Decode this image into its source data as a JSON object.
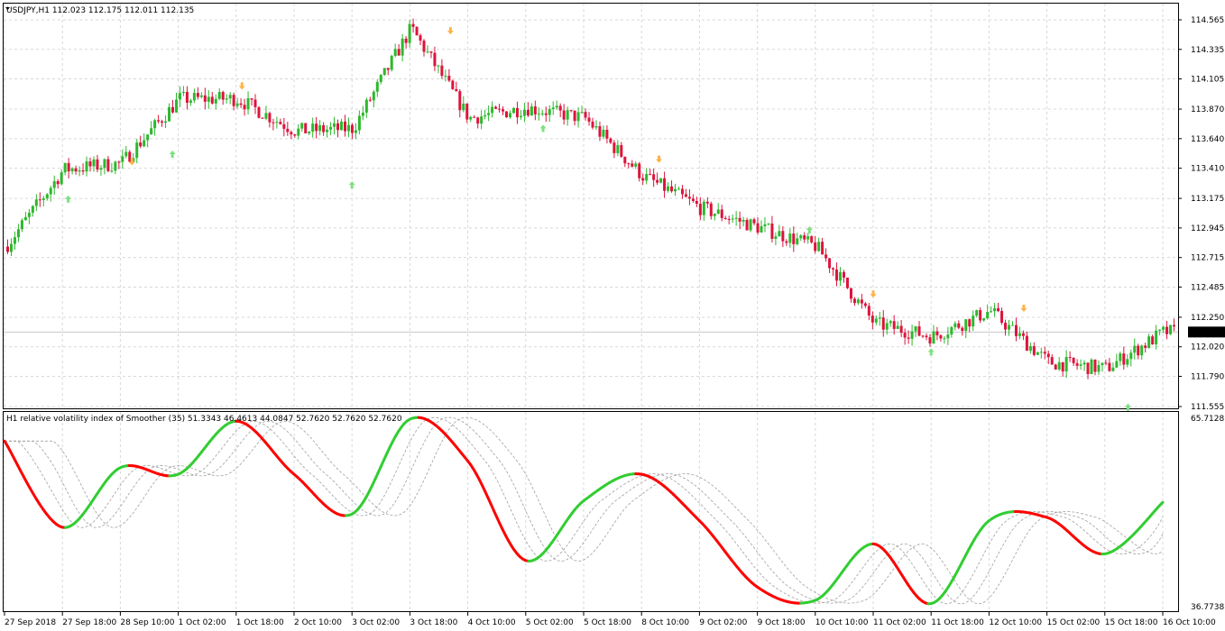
{
  "main_panel": {
    "header": "USDJPY,H1  112.023 112.175 112.011 112.135",
    "current_price": "112.135",
    "price_labels": [
      "114.565",
      "114.335",
      "114.105",
      "113.870",
      "113.640",
      "113.410",
      "113.175",
      "112.945",
      "112.715",
      "112.485",
      "112.250",
      "112.020",
      "111.790",
      "111.555"
    ]
  },
  "indicator_panel": {
    "header": "H1 relative volatility index of Smoother (35) 51.3343 46.4613 44.0847 52.7620 52.7620 52.7620",
    "scale_top": "65.7128",
    "scale_bottom": "36.7738"
  },
  "time_labels": [
    "27 Sep 2018",
    "27 Sep 18:00",
    "28 Sep 10:00",
    "1 Oct 02:00",
    "1 Oct 18:00",
    "2 Oct 10:00",
    "3 Oct 02:00",
    "3 Oct 18:00",
    "4 Oct 10:00",
    "5 Oct 02:00",
    "5 Oct 18:00",
    "8 Oct 10:00",
    "9 Oct 02:00",
    "9 Oct 18:00",
    "10 Oct 10:00",
    "11 Oct 02:00",
    "11 Oct 18:00",
    "12 Oct 10:00",
    "15 Oct 02:00",
    "15 Oct 18:00",
    "16 Oct 10:00"
  ],
  "colors": {
    "bull": "#2db82d",
    "bear": "#dc143c",
    "rvi_up": "#32cd32",
    "rvi_down": "#ff0000",
    "arrow_up": "#7fe07f",
    "arrow_down": "#ffb347",
    "grid": "#d8d8d8"
  },
  "chart_data": {
    "type": "candlestick",
    "symbol": "USDJPY",
    "timeframe": "H1",
    "ylim": [
      111.555,
      114.565
    ],
    "close_path": [
      {
        "t": "27 Sep 2018",
        "p": 112.8
      },
      {
        "t": "27 Sep 18:00",
        "p": 113.4
      },
      {
        "t": "28 Sep 10:00",
        "p": 113.45
      },
      {
        "t": "1 Oct 02:00",
        "p": 113.95
      },
      {
        "t": "1 Oct 18:00",
        "p": 113.95
      },
      {
        "t": "2 Oct 10:00",
        "p": 113.7
      },
      {
        "t": "3 Oct 02:00",
        "p": 113.72
      },
      {
        "t": "3 Oct 18:00",
        "p": 114.5
      },
      {
        "t": "4 Oct 10:00",
        "p": 113.8
      },
      {
        "t": "5 Oct 02:00",
        "p": 113.88
      },
      {
        "t": "5 Oct 18:00",
        "p": 113.8
      },
      {
        "t": "8 Oct 10:00",
        "p": 113.35
      },
      {
        "t": "9 Oct 02:00",
        "p": 113.1
      },
      {
        "t": "9 Oct 18:00",
        "p": 112.95
      },
      {
        "t": "10 Oct 10:00",
        "p": 112.8
      },
      {
        "t": "11 Oct 02:00",
        "p": 112.2
      },
      {
        "t": "11 Oct 18:00",
        "p": 112.1
      },
      {
        "t": "12 Oct 10:00",
        "p": 112.3
      },
      {
        "t": "15 Oct 02:00",
        "p": 111.9
      },
      {
        "t": "15 Oct 18:00",
        "p": 111.85
      },
      {
        "t": "16 Oct 10:00",
        "p": 112.135
      }
    ],
    "rvi": {
      "ylim": [
        36.7738,
        65.7128
      ],
      "points": [
        {
          "t": "27 Sep 2018",
          "v": 62.0
        },
        {
          "t": "27 Sep 18:00",
          "v": 49.0
        },
        {
          "t": "28 Sep 10:00",
          "v": 58.0
        },
        {
          "t": "1 Oct 02:00",
          "v": 57.0
        },
        {
          "t": "1 Oct 18:00",
          "v": 65.0
        },
        {
          "t": "2 Oct 10:00",
          "v": 57.0
        },
        {
          "t": "3 Oct 02:00",
          "v": 51.0
        },
        {
          "t": "3 Oct 18:00",
          "v": 65.3
        },
        {
          "t": "4 Oct 10:00",
          "v": 59.0
        },
        {
          "t": "5 Oct 02:00",
          "v": 44.0
        },
        {
          "t": "5 Oct 18:00",
          "v": 53.0
        },
        {
          "t": "8 Oct 10:00",
          "v": 57.0
        },
        {
          "t": "9 Oct 02:00",
          "v": 50.0
        },
        {
          "t": "9 Oct 18:00",
          "v": 40.0
        },
        {
          "t": "10 Oct 10:00",
          "v": 38.0
        },
        {
          "t": "11 Oct 02:00",
          "v": 46.5
        },
        {
          "t": "11 Oct 18:00",
          "v": 37.5
        },
        {
          "t": "12 Oct 10:00",
          "v": 50.0
        },
        {
          "t": "15 Oct 02:00",
          "v": 50.5
        },
        {
          "t": "15 Oct 18:00",
          "v": 45.0
        },
        {
          "t": "16 Oct 10:00",
          "v": 52.762
        }
      ]
    }
  }
}
